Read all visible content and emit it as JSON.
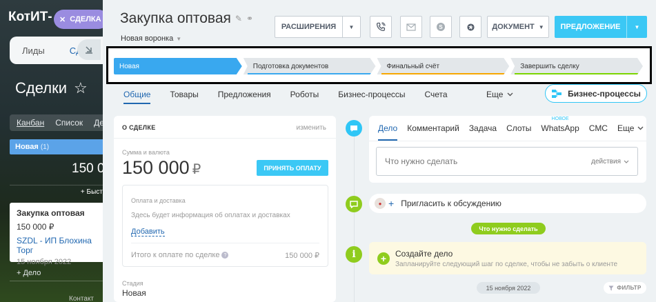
{
  "background_app": {
    "logo": "КотИТ-",
    "close_chip_label": "СДЕЛКА",
    "tabs": [
      {
        "label": "Лиды"
      },
      {
        "label": "Сд"
      }
    ],
    "page_title": "Сделки",
    "views": [
      {
        "label": "Канбан"
      },
      {
        "label": "Список"
      },
      {
        "label": "Де"
      }
    ],
    "stage_label": "Новая",
    "stage_count": "(1)",
    "stage_sum": "150 0",
    "quick_add": "+ Быстра",
    "card": {
      "title": "Закупка оптовая",
      "sum": "150 000 ₽",
      "client": "SZDL - ИП Блохина Торг",
      "date": "15 ноября 2022"
    },
    "add_deal": "+ Дело",
    "bottom_text": "Контакт"
  },
  "header": {
    "title": "Закупка оптовая",
    "funnel": "Новая воронка",
    "extensions_label": "РАСШИРЕНИЯ",
    "document_label": "ДОКУМЕНТ",
    "offer_label": "ПРЕДЛОЖЕНИЕ"
  },
  "stages": [
    {
      "label": "Новая",
      "color": "#39a8ef"
    },
    {
      "label": "Подготовка документов",
      "color": "#39a8ef"
    },
    {
      "label": "Финальный счёт",
      "color": "#f7a700"
    },
    {
      "label": "Завершить сделку",
      "color": "#7bd500"
    }
  ],
  "tabs": {
    "items": [
      {
        "label": "Общие"
      },
      {
        "label": "Товары"
      },
      {
        "label": "Предложения"
      },
      {
        "label": "Роботы"
      },
      {
        "label": "Бизнес-процессы"
      },
      {
        "label": "Счета"
      }
    ],
    "more_label": "Еще",
    "bp_button": "Бизнес-процессы"
  },
  "deal": {
    "heading": "О СДЕЛКЕ",
    "edit_label": "изменить",
    "sum_label": "Сумма и валюта",
    "sum_value": "150 000",
    "currency": "₽",
    "pay_button": "ПРИНЯТЬ ОПЛАТУ",
    "payment": {
      "label": "Оплата и доставка",
      "hint": "Здесь будет информация об оплатах и доставках",
      "add_link": "Добавить",
      "total_label": "Итого к оплате по сделке",
      "total_value": "150 000 ₽"
    },
    "stage_label": "Стадия",
    "stage_value": "Новая"
  },
  "activity": {
    "tabs": [
      {
        "label": "Дело",
        "badge": ""
      },
      {
        "label": "Комментарий",
        "badge": ""
      },
      {
        "label": "Задача",
        "badge": ""
      },
      {
        "label": "Слоты",
        "badge": ""
      },
      {
        "label": "WhatsApp",
        "badge": "НОВОЕ"
      },
      {
        "label": "СМС",
        "badge": ""
      }
    ],
    "more_label": "Еще",
    "input_placeholder": "Что нужно сделать",
    "actions_label": "действия"
  },
  "invite_label": "Пригласить к обсуждению",
  "todo_badge": "Что нужно сделать",
  "create": {
    "title": "Создайте дело",
    "subtitle": "Запланируйте следующий шаг по сделке, чтобы не забыть о клиенте"
  },
  "date_badge": "15 ноября 2022",
  "filter_label": "ФИЛЬТР",
  "colors": {
    "accent": "#3bc8f5",
    "link": "#2067b0",
    "green": "#8fcc1e"
  }
}
